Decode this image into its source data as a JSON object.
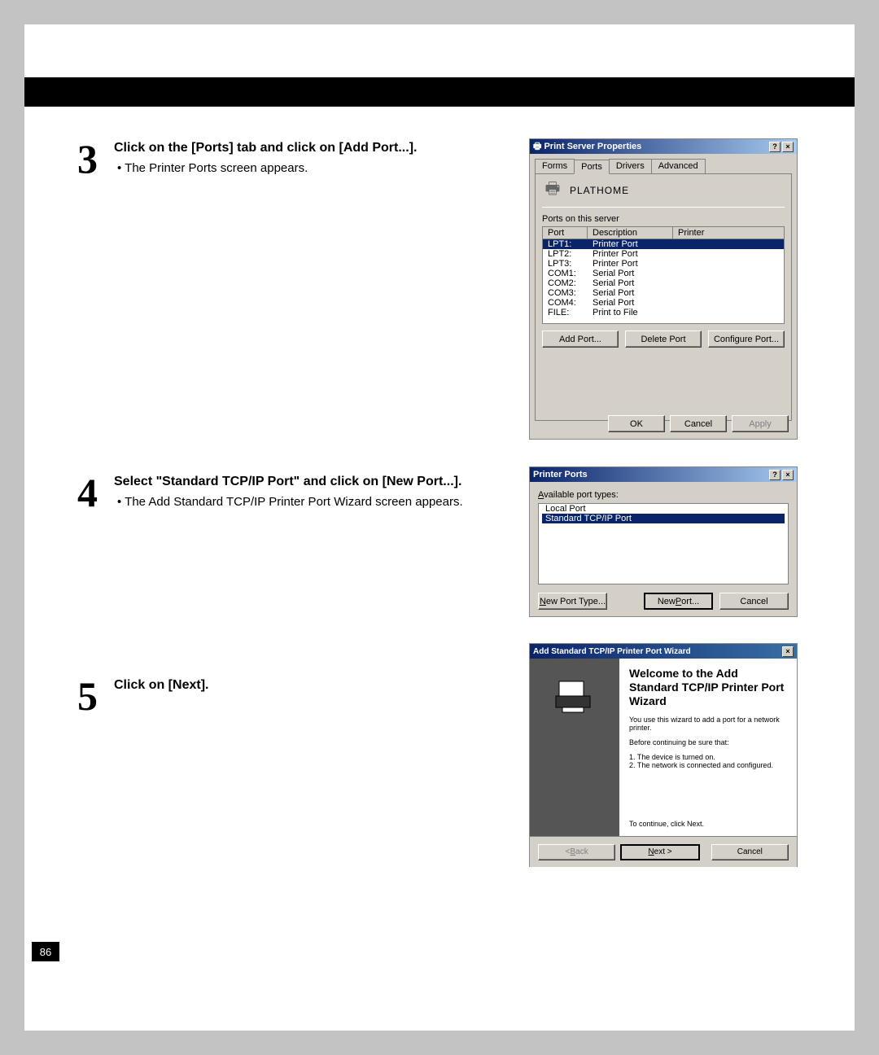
{
  "page_number": "86",
  "steps": [
    {
      "num": "3",
      "title": "Click on the [Ports] tab and click on [Add Port...].",
      "bullet": "The Printer Ports screen appears."
    },
    {
      "num": "4",
      "title": "Select \"Standard TCP/IP Port\" and click on [New Port...].",
      "bullet": "The Add Standard TCP/IP Printer Port Wizard screen appears."
    },
    {
      "num": "5",
      "title": "Click on [Next].",
      "bullet": ""
    }
  ],
  "dialog1": {
    "title": "Print Server Properties",
    "tabs": [
      "Forms",
      "Ports",
      "Drivers",
      "Advanced"
    ],
    "active_tab": "Ports",
    "server_name": "PLATHOME",
    "ports_label": "Ports on this server",
    "headers": {
      "port": "Port",
      "desc": "Description",
      "printer": "Printer"
    },
    "rows": [
      {
        "port": "LPT1:",
        "desc": "Printer Port",
        "selected": true
      },
      {
        "port": "LPT2:",
        "desc": "Printer Port"
      },
      {
        "port": "LPT3:",
        "desc": "Printer Port"
      },
      {
        "port": "COM1:",
        "desc": "Serial Port"
      },
      {
        "port": "COM2:",
        "desc": "Serial Port"
      },
      {
        "port": "COM3:",
        "desc": "Serial Port"
      },
      {
        "port": "COM4:",
        "desc": "Serial Port"
      },
      {
        "port": "FILE:",
        "desc": "Print to File"
      }
    ],
    "buttons": {
      "add": "Add Port...",
      "delete": "Delete Port",
      "configure": "Configure Port..."
    },
    "dialog_buttons": {
      "ok": "OK",
      "cancel": "Cancel",
      "apply": "Apply"
    }
  },
  "dialog2": {
    "title": "Printer Ports",
    "label_pre": "A",
    "label_rest": "vailable port types:",
    "types": [
      {
        "name": "Local Port"
      },
      {
        "name": "Standard TCP/IP Port",
        "selected": true
      }
    ],
    "buttons": {
      "new_type_pre": "N",
      "new_type_rest": "ew Port Type...",
      "new_port_pre": "New ",
      "new_port_u": "P",
      "new_port_rest": "ort...",
      "cancel": "Cancel"
    }
  },
  "dialog3": {
    "title": "Add Standard TCP/IP Printer Port Wizard",
    "heading": "Welcome to the Add Standard TCP/IP Printer Port Wizard",
    "lead": "You use this wizard to add a port for a network printer.",
    "before": "Before continuing be sure that:",
    "item1": "1.  The device is turned on.",
    "item2": "2.  The network is connected and configured.",
    "continue": "To continue, click Next.",
    "buttons": {
      "back_pre": "< ",
      "back_u": "B",
      "back_rest": "ack",
      "next_u": "N",
      "next_rest": "ext >",
      "cancel": "Cancel"
    }
  }
}
